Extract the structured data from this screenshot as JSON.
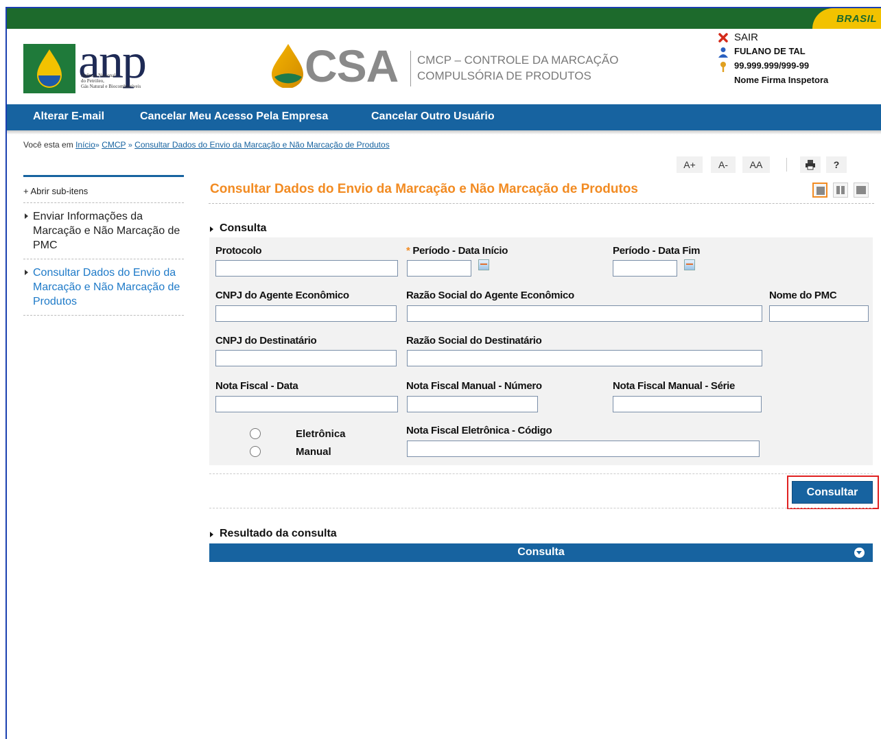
{
  "gov_bar": {
    "brand": "BRASIL"
  },
  "header": {
    "anp": {
      "word": "anp",
      "subtitle_lines": [
        "Agência Nacional",
        "do Petróleo,",
        "Gás Natural e Biocombustíveis"
      ]
    },
    "csa": {
      "word": "CSA",
      "line1": "CMCP – CONTROLE DA MARCAÇÃO",
      "line2": "COMPULSÓRIA DE PRODUTOS"
    },
    "user": {
      "logout_label": "SAIR",
      "name": "FULANO DE TAL",
      "document": "99.999.999/999-99",
      "company": "Nome Firma Inspetora"
    }
  },
  "nav": {
    "items": [
      {
        "label": "Alterar E-mail"
      },
      {
        "label": "Cancelar Meu Acesso Pela Empresa"
      },
      {
        "label": "Cancelar Outro Usuário"
      }
    ]
  },
  "breadcrumb": {
    "prefix": "Você esta em",
    "items": [
      "Início",
      "CMCP",
      "Consultar Dados do Envio da Marcação e Não Marcação de Produtos"
    ],
    "separator": "»"
  },
  "tools": {
    "font_increase": "A+",
    "font_decrease": "A-",
    "font_reset": "AA",
    "help": "?"
  },
  "sidebar": {
    "expand_label": "+ Abrir sub-itens",
    "items": [
      {
        "label": "Enviar Informações da Marcação e Não Marcação de PMC",
        "active": false
      },
      {
        "label": "Consultar Dados do Envio da Marcação e Não Marcação de Produtos",
        "active": true
      }
    ]
  },
  "main": {
    "title": "Consultar Dados do Envio da Marcação e Não Marcação de Produtos",
    "consulta_section": "Consulta",
    "fields": {
      "protocolo": {
        "label": "Protocolo",
        "value": ""
      },
      "data_inicio": {
        "required_mark": "*",
        "label": "Período - Data Início",
        "value": ""
      },
      "data_fim": {
        "label": "Período - Data Fim",
        "value": ""
      },
      "cnpj_agente": {
        "label": "CNPJ do Agente Econômico",
        "value": ""
      },
      "razao_agente": {
        "label": "Razão Social do Agente Econômico",
        "value": ""
      },
      "nome_pmc": {
        "label": "Nome do PMC",
        "value": ""
      },
      "cnpj_destinatario": {
        "label": "CNPJ do Destinatário",
        "value": ""
      },
      "razao_destinatario": {
        "label": "Razão Social do Destinatário",
        "value": ""
      },
      "nf_data": {
        "label": "Nota Fiscal - Data",
        "value": ""
      },
      "nf_manual_numero": {
        "label": "Nota Fiscal Manual - Número",
        "value": ""
      },
      "nf_manual_serie": {
        "label": "Nota Fiscal Manual - Série",
        "value": ""
      },
      "nf_eletronica_codigo": {
        "label": "Nota Fiscal Eletrônica - Código",
        "value": ""
      }
    },
    "radio_options": [
      "Eletrônica",
      "Manual"
    ],
    "submit_label": "Consultar",
    "result_section": "Resultado da consulta",
    "result_bar_label": "Consulta"
  },
  "colors": {
    "nav_blue": "#1763a0",
    "title_orange": "#f28b22",
    "gov_green": "#1d6a2c",
    "gov_yellow": "#f2c200",
    "highlight_red": "#e02020"
  }
}
